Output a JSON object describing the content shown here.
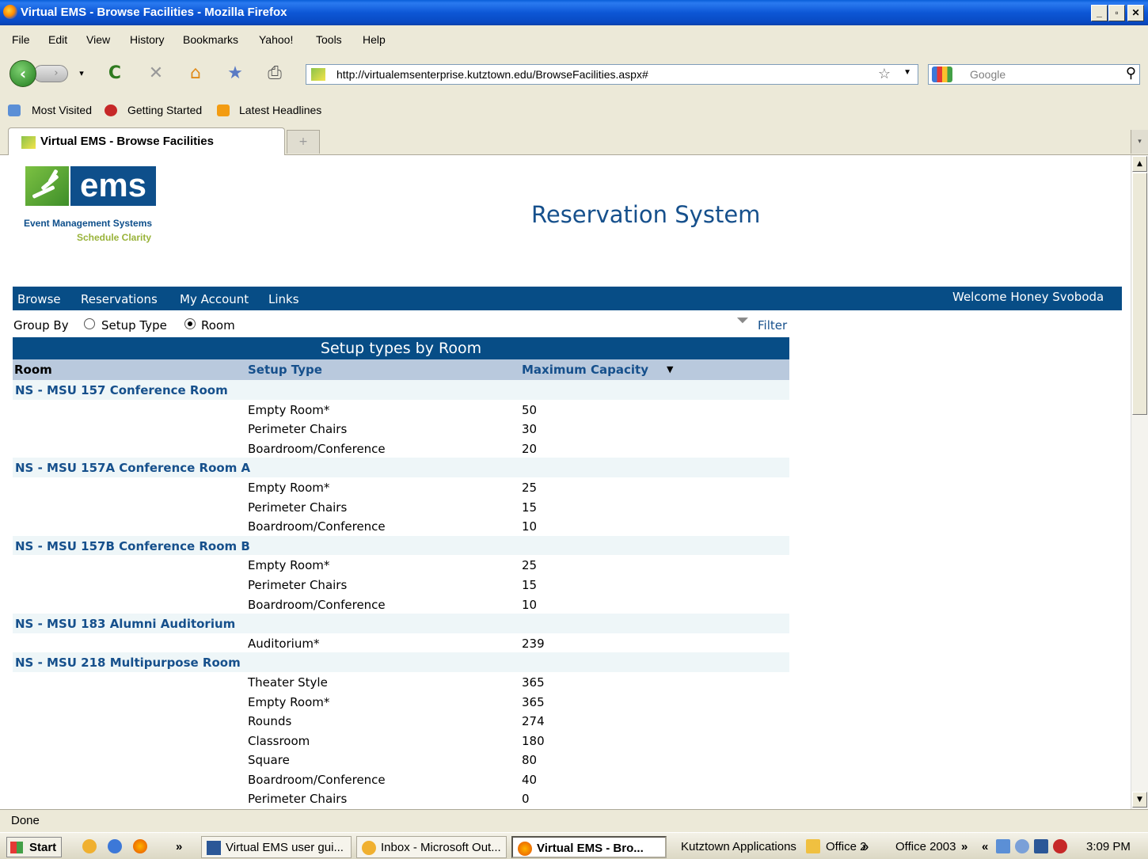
{
  "window": {
    "title": "Virtual EMS - Browse Facilities - Mozilla Firefox"
  },
  "menu": [
    "File",
    "Edit",
    "View",
    "History",
    "Bookmarks",
    "Yahoo!",
    "Tools",
    "Help"
  ],
  "address": {
    "url": "http://virtualemsenterprise.kutztown.edu/BrowseFacilities.aspx#"
  },
  "search": {
    "placeholder": "Google"
  },
  "bookmarks": [
    "Most Visited",
    "Getting Started",
    "Latest Headlines"
  ],
  "tab": {
    "title": "Virtual EMS - Browse Facilities",
    "new_tab": "+"
  },
  "logo": {
    "word": "ems",
    "line1": "Event Management Systems",
    "line2": "Schedule Clarity"
  },
  "page": {
    "title": "Reservation System"
  },
  "sitenav": {
    "items": [
      "Browse",
      "Reservations",
      "My Account",
      "Links"
    ],
    "welcome": "Welcome Honey Svoboda"
  },
  "groupby": {
    "label": "Group By",
    "option_setup": "Setup Type",
    "option_room": "Room",
    "selected": "Room",
    "filter": "Filter"
  },
  "grid": {
    "title": "Setup types by Room",
    "columns": [
      "Room",
      "Setup Type",
      "Maximum Capacity"
    ],
    "sort_indicator": "▼",
    "rows": [
      {
        "type": "room",
        "name": "NS - MSU 157 Conference Room"
      },
      {
        "type": "setup",
        "setup": "Empty Room*",
        "capacity": "50"
      },
      {
        "type": "setup",
        "setup": "Perimeter Chairs",
        "capacity": "30"
      },
      {
        "type": "setup",
        "setup": "Boardroom/Conference",
        "capacity": "20"
      },
      {
        "type": "room",
        "name": "NS - MSU 157A Conference Room A"
      },
      {
        "type": "setup",
        "setup": "Empty Room*",
        "capacity": "25"
      },
      {
        "type": "setup",
        "setup": "Perimeter Chairs",
        "capacity": "15"
      },
      {
        "type": "setup",
        "setup": "Boardroom/Conference",
        "capacity": "10"
      },
      {
        "type": "room",
        "name": "NS - MSU 157B Conference Room B"
      },
      {
        "type": "setup",
        "setup": "Empty Room*",
        "capacity": "25"
      },
      {
        "type": "setup",
        "setup": "Perimeter Chairs",
        "capacity": "15"
      },
      {
        "type": "setup",
        "setup": "Boardroom/Conference",
        "capacity": "10"
      },
      {
        "type": "room",
        "name": "NS - MSU 183 Alumni Auditorium"
      },
      {
        "type": "setup",
        "setup": "Auditorium*",
        "capacity": "239"
      },
      {
        "type": "room",
        "name": "NS - MSU 218 Multipurpose Room"
      },
      {
        "type": "setup",
        "setup": "Theater Style",
        "capacity": "365"
      },
      {
        "type": "setup",
        "setup": "Empty Room*",
        "capacity": "365"
      },
      {
        "type": "setup",
        "setup": "Rounds",
        "capacity": "274"
      },
      {
        "type": "setup",
        "setup": "Classroom",
        "capacity": "180"
      },
      {
        "type": "setup",
        "setup": "Square",
        "capacity": "80"
      },
      {
        "type": "setup",
        "setup": "Boardroom/Conference",
        "capacity": "40"
      },
      {
        "type": "setup",
        "setup": "Perimeter Chairs",
        "capacity": "0"
      }
    ]
  },
  "status": {
    "text": "Done"
  },
  "taskbar": {
    "start": "Start",
    "chevron": "»",
    "tasks": [
      "Virtual EMS user gui...",
      "Inbox - Microsoft Out...",
      "Virtual EMS - Bro..."
    ],
    "toolbars": [
      "Kutztown Applications",
      "Office 2",
      "»",
      "Office 2003",
      "»",
      "«"
    ],
    "clock": "3:09 PM"
  },
  "colors": {
    "brand_blue": "#074d86",
    "link_blue": "#16508c",
    "header_bg": "#b9c9dd",
    "room_row_bg": "#eef6f8"
  }
}
